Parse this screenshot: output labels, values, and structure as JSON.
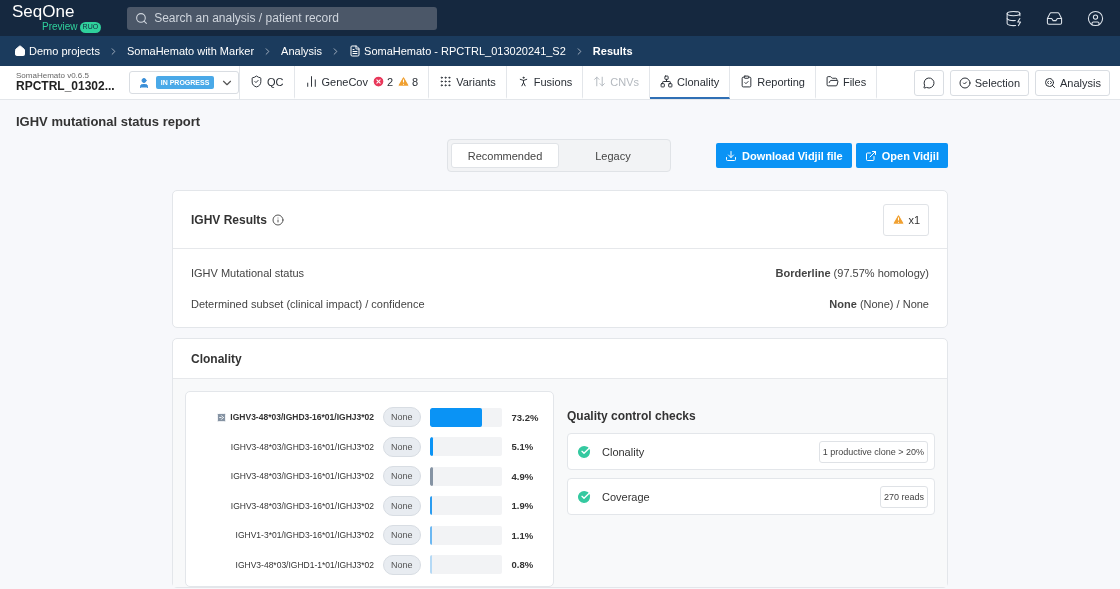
{
  "header": {
    "logo": "SeqOne",
    "logo_sub": "Preview",
    "logo_badge": "RUO",
    "search": {
      "placeholder": "Search an analysis / patient record"
    }
  },
  "breadcrumbs": [
    {
      "label": "Demo projects",
      "kind": "home"
    },
    {
      "label": "SomaHemato with Marker",
      "kind": "link"
    },
    {
      "label": "Analysis",
      "kind": "link"
    },
    {
      "label": "SomaHemato - RPCTRL_013020241_S2",
      "kind": "file"
    },
    {
      "label": "Results",
      "kind": "current"
    }
  ],
  "analysis": {
    "pipeline": "SomaHemato v0.6.5",
    "name": "RPCTRL_01302...",
    "status": "IN PROGRESS"
  },
  "tabs": [
    {
      "label": "QC",
      "kind": "qc",
      "selected": false,
      "disabled": false
    },
    {
      "label": "GeneCov",
      "kind": "genecov",
      "selected": false,
      "disabled": false,
      "errors": "2",
      "warnings": "8"
    },
    {
      "label": "Variants",
      "kind": "variants",
      "selected": false,
      "disabled": false
    },
    {
      "label": "Fusions",
      "kind": "fusions",
      "selected": false,
      "disabled": false
    },
    {
      "label": "CNVs",
      "kind": "cnvs",
      "selected": false,
      "disabled": true
    },
    {
      "label": "Clonality",
      "kind": "clonality",
      "selected": true,
      "disabled": false
    },
    {
      "label": "Reporting",
      "kind": "reporting",
      "selected": false,
      "disabled": false
    },
    {
      "label": "Files",
      "kind": "files",
      "selected": false,
      "disabled": false
    }
  ],
  "actions": [
    "Selection",
    "Analysis"
  ],
  "page_title": "IGHV mutational status report",
  "view_toggle": [
    {
      "label": "Recommended",
      "selected": true
    },
    {
      "label": "Legacy",
      "selected": false
    }
  ],
  "buttons": [
    {
      "label": "Download Vidjil file",
      "kind": "download"
    },
    {
      "label": "Open Vidjil",
      "kind": "open"
    }
  ],
  "results": {
    "title": "IGHV Results",
    "warning_count": "x1",
    "rows": [
      {
        "label": "IGHV Mutational status",
        "value": "**Borderline** (97.57% homology)"
      },
      {
        "label": "Determined subset (clinical impact) / confidence",
        "value": "**None** (None) / None"
      }
    ]
  },
  "clonality": {
    "title": "Clonality",
    "clones": [
      {
        "name": "IGHV3-48*03/IGHD3-16*01/IGHJ3*02",
        "tag": "None",
        "level": 0.732,
        "reading": "73.2%",
        "color": "#0a93f5",
        "main": true
      },
      {
        "name": "IGHV3-48*03/IGHD3-16*01/IGHJ3*02",
        "tag": "None",
        "level": 0.051,
        "reading": "5.1%",
        "color": "#0a93f5",
        "main": false
      },
      {
        "name": "IGHV3-48*03/IGHD3-16*01/IGHJ3*02",
        "tag": "None",
        "level": 0.049,
        "reading": "4.9%",
        "color": "#8593a3",
        "main": false
      },
      {
        "name": "IGHV3-48*03/IGHD3-16*01/IGHJ3*02",
        "tag": "None",
        "level": 0.019,
        "reading": "1.9%",
        "color": "#2a9cf0",
        "main": false
      },
      {
        "name": "IGHV1-3*01/IGHD3-16*01/IGHJ3*02",
        "tag": "None",
        "level": 0.011,
        "reading": "1.1%",
        "color": "#6cb8f2",
        "main": false
      },
      {
        "name": "IGHV3-48*03/IGHD1-1*01/IGHJ3*02",
        "tag": "None",
        "level": 0.008,
        "reading": "0.8%",
        "color": "#b5d9f5",
        "main": false
      }
    ],
    "qc": {
      "title": "Quality control checks",
      "checks": [
        {
          "label": "Clonality",
          "value": "1 productive clone > 20%",
          "passed": true
        },
        {
          "label": "Coverage",
          "value": "270 reads",
          "passed": true
        }
      ]
    }
  }
}
